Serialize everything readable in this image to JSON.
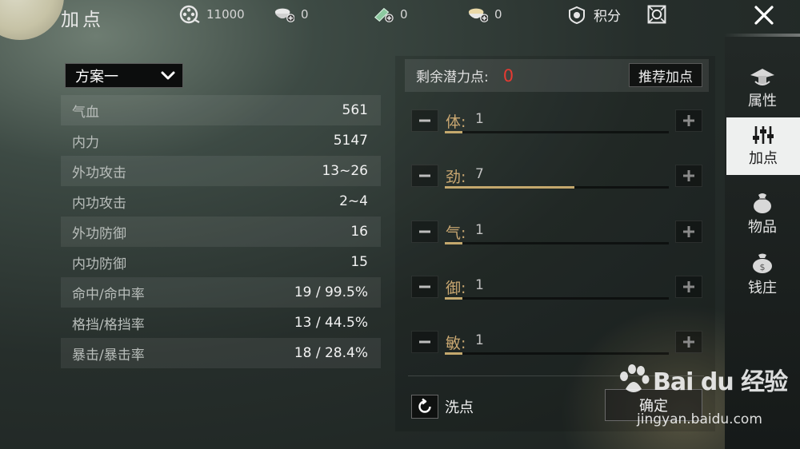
{
  "header": {
    "title": "加点",
    "resources": [
      {
        "icon": "film-reel-icon",
        "value": "11000"
      },
      {
        "icon": "rice-bowl-plus-icon",
        "value": "0"
      },
      {
        "icon": "jade-plus-icon",
        "value": "0"
      },
      {
        "icon": "gold-bowl-plus-icon",
        "value": "0"
      }
    ],
    "points_label": "积分",
    "points_icon": "shield-badge-icon",
    "settings_icon": "settings-frame-icon",
    "close_icon": "close-icon"
  },
  "plan": {
    "selected": "方案一"
  },
  "stats": [
    {
      "label": "气血",
      "value": "561"
    },
    {
      "label": "内力",
      "value": "5147"
    },
    {
      "label": "外功攻击",
      "value": "13~26"
    },
    {
      "label": "内功攻击",
      "value": "2~4"
    },
    {
      "label": "外功防御",
      "value": "16"
    },
    {
      "label": "内功防御",
      "value": "15"
    },
    {
      "label": "命中/命中率",
      "value": "19 / 99.5%"
    },
    {
      "label": "格挡/格挡率",
      "value": "13 / 44.5%"
    },
    {
      "label": "暴击/暴击率",
      "value": "18 / 28.4%"
    }
  ],
  "points": {
    "remaining_label": "剩余潜力点:",
    "remaining_value": "0",
    "remaining_color": "#e53a32",
    "recommend_label": "推荐加点"
  },
  "attributes": [
    {
      "name": "体",
      "value": "1",
      "fill": 0.08
    },
    {
      "name": "劲",
      "value": "7",
      "fill": 0.58
    },
    {
      "name": "气",
      "value": "1",
      "fill": 0.08
    },
    {
      "name": "御",
      "value": "1",
      "fill": 0.08
    },
    {
      "name": "敏",
      "value": "1",
      "fill": 0.08
    }
  ],
  "actions": {
    "reset_label": "洗点",
    "confirm_label": "确定"
  },
  "sidebar": {
    "tabs": [
      {
        "label": "属性",
        "icon": "hat-icon",
        "active": false
      },
      {
        "label": "加点",
        "icon": "sliders-icon",
        "active": true
      },
      {
        "label": "物品",
        "icon": "bag-icon",
        "active": false
      },
      {
        "label": "钱庄",
        "icon": "money-bag-icon",
        "active": false
      }
    ]
  },
  "watermark": {
    "logo": "Bai du 经验",
    "url": "jingyan.baidu.com"
  },
  "colors": {
    "accent_gold": "#c9a771",
    "bar_fill": "#c4a86d",
    "active_tab_bg": "#eef0ef"
  }
}
